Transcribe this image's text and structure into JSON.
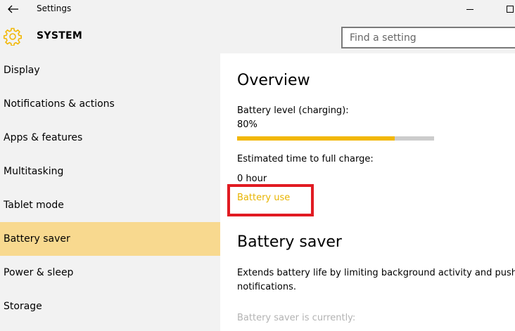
{
  "window": {
    "title": "Settings"
  },
  "header": {
    "section_title": "SYSTEM",
    "search_placeholder": "Find a setting"
  },
  "sidebar": {
    "items": [
      {
        "label": "Display"
      },
      {
        "label": "Notifications & actions"
      },
      {
        "label": "Apps & features"
      },
      {
        "label": "Multitasking"
      },
      {
        "label": "Tablet mode"
      },
      {
        "label": "Battery saver",
        "selected": true
      },
      {
        "label": "Power & sleep"
      },
      {
        "label": "Storage"
      }
    ]
  },
  "main": {
    "overview_heading": "Overview",
    "battery_level_label": "Battery level (charging):",
    "battery_level_value": "80%",
    "battery_level_fraction": 0.8,
    "estimated_label": "Estimated time to full charge:",
    "estimated_value": "0 hour",
    "battery_use_link": "Battery use",
    "battery_saver_heading": "Battery saver",
    "description_line1": "Extends battery life by limiting background activity and push",
    "description_line2": "notifications.",
    "status_label": "Battery saver is currently:"
  },
  "colors": {
    "accent": "#f2b705",
    "selected_bg": "#f8d98f",
    "highlight_border": "#e11b22"
  }
}
